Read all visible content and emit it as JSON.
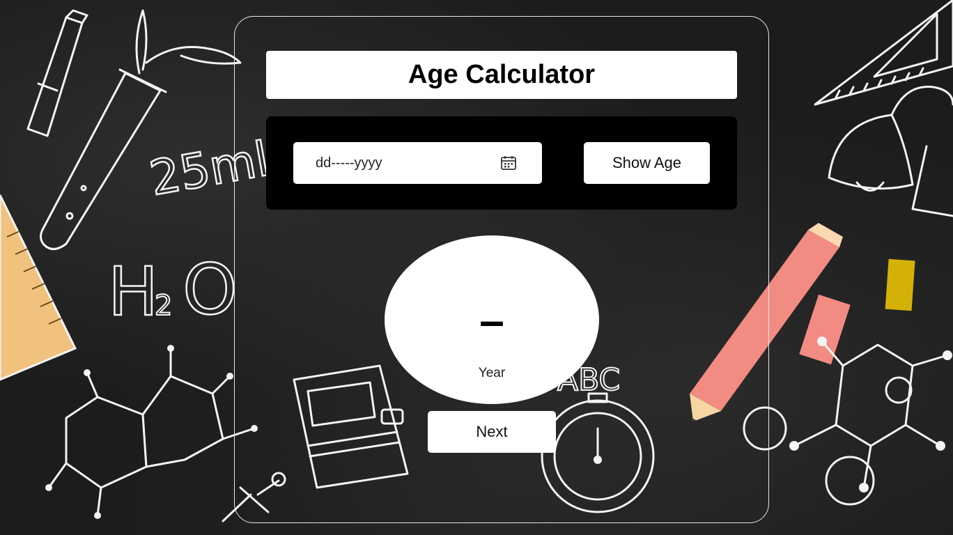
{
  "app": {
    "title": "Age Calculator"
  },
  "form": {
    "date_placeholder": "dd-----yyyy",
    "show_button_label": "Show Age"
  },
  "result": {
    "value": "–",
    "unit": "Year"
  },
  "actions": {
    "next_button_label": "Next"
  },
  "background": {
    "chalk_labels": {
      "volume": "25ml",
      "formula_h": "H",
      "formula_2": "2",
      "formula_o": "O",
      "abc": "ABC"
    }
  },
  "icons": {
    "date_picker": "calendar-icon"
  },
  "colors": {
    "background": "#1c1c1c",
    "panel": "#000000",
    "surface": "#ffffff",
    "text": "#000000"
  }
}
